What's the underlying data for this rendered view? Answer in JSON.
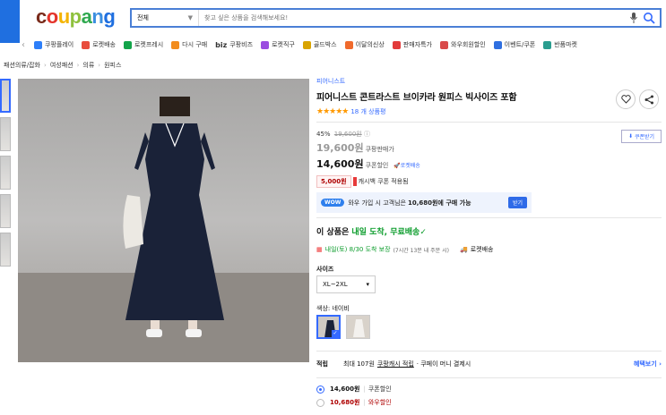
{
  "header": {
    "logo_text": "coupang",
    "search_category": "전체",
    "search_placeholder": "찾고 싶은 상품을 검색해보세요!"
  },
  "nav_items": [
    {
      "label": "쿠팡플레이",
      "color": "#2d7ff9"
    },
    {
      "label": "로켓배송",
      "color": "#e84c3d"
    },
    {
      "label": "로켓프레시",
      "color": "#13a44a"
    },
    {
      "label": "다시 구매",
      "color": "#f28c1d"
    },
    {
      "label": "쿠팡비즈",
      "color": "#111111"
    },
    {
      "label": "로켓직구",
      "color": "#9b4de0"
    },
    {
      "label": "골드박스",
      "color": "#d9a400"
    },
    {
      "label": "이달의신상",
      "color": "#f06a2c"
    },
    {
      "label": "판매자특가",
      "color": "#e23b3b"
    },
    {
      "label": "와우회원할인",
      "color": "#d94a4a"
    },
    {
      "label": "이벤트/쿠폰",
      "color": "#2f6fe0"
    },
    {
      "label": "반품마켓",
      "color": "#2a9d8f"
    }
  ],
  "nav_biz_prefix": "biz",
  "breadcrumbs": [
    "패션의류/잡화",
    "여성패션",
    "의류",
    "원피스"
  ],
  "product": {
    "brand": "피어니스트",
    "title": "피어니스트 콘트라스트 브이카라 원피스 빅사이즈 포함",
    "review_count": "18 개 상품평",
    "stars": "★★★★★"
  },
  "price": {
    "discount_rate": "45%",
    "original_price": "19,600원",
    "sale_price": "19,600원",
    "sale_price_label": "쿠팡판매가",
    "coupon_price": "14,600원",
    "coupon_price_label": "쿠폰할인",
    "rocket_badge": "로켓배송",
    "coupon_button": "쿠폰받기",
    "cashback_amount": "5,000원",
    "cashback_text": "캐시백 쿠폰 적용됨",
    "wow_badge": "WOW",
    "wow_text": "와우 가입 시 고객님은",
    "wow_bold": "10,680원에 구매 가능",
    "wow_join": "받기"
  },
  "shipping": {
    "headline_prefix": "이 상품은",
    "headline_highlight": "내일 도착, 무료배송",
    "arrival": "내일(토) 8/30 도착 보장",
    "arrival_note": "(7시간 13분 내 주문 시)",
    "rocket_label": "로켓배송"
  },
  "options": {
    "size_label": "사이즈",
    "size_value": "XL~2XL",
    "color_label": "색상: 네이비"
  },
  "savings": {
    "label": "적립",
    "text_before": "최대 107원",
    "text_link": "쿠팡캐시 적립",
    "text_after": "· 쿠페이 머니 결제시",
    "more": "혜택보기"
  },
  "price_options": [
    {
      "price": "14,600원",
      "label": "쿠폰할인",
      "selected": true,
      "color": "#111111"
    },
    {
      "price": "10,680원",
      "label": "와우할인",
      "selected": false,
      "color": "#ae0000"
    }
  ]
}
